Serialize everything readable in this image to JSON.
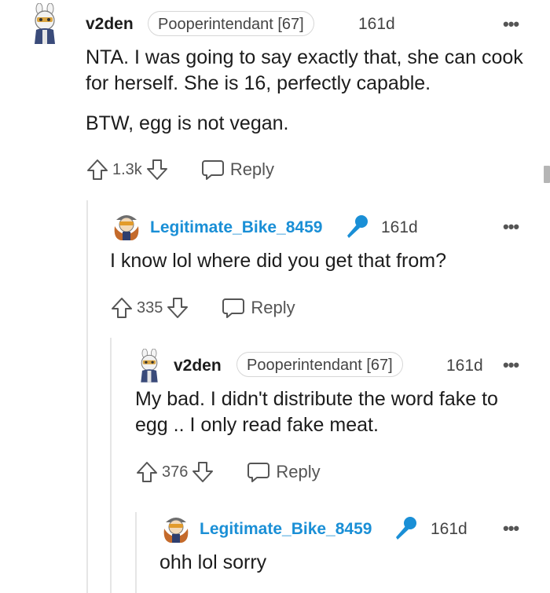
{
  "comments": [
    {
      "author": "v2den",
      "flair": "Pooperintendant [67]",
      "age": "161d",
      "more": "•••",
      "paragraphs": [
        "NTA. I was going to say exactly that, she can cook for herself. She is 16, perfectly capable.",
        "BTW, egg is not vegan."
      ],
      "score": "1.3k",
      "reply_label": "Reply"
    },
    {
      "author": "Legitimate_Bike_8459",
      "age": "161d",
      "more": "•••",
      "paragraphs": [
        "I know lol where did you get that from?"
      ],
      "score": "335",
      "reply_label": "Reply"
    },
    {
      "author": "v2den",
      "flair": "Pooperintendant [67]",
      "age": "161d",
      "more": "•••",
      "paragraphs": [
        "My bad. I didn't distribute the word fake to egg .. I only read fake meat."
      ],
      "score": "376",
      "reply_label": "Reply"
    },
    {
      "author": "Legitimate_Bike_8459",
      "age": "161d",
      "more": "•••",
      "paragraphs": [
        "ohh lol sorry"
      ]
    }
  ],
  "icons": {
    "upvote": "arrow-up-outline",
    "downvote": "arrow-down-outline",
    "reply": "speech-bubble",
    "mic": "microphone",
    "more": "ellipsis"
  },
  "colors": {
    "op_link": "#1a8fd6",
    "text": "#1c1c1c",
    "muted": "#555555",
    "thread_line": "#e6e6e6"
  }
}
